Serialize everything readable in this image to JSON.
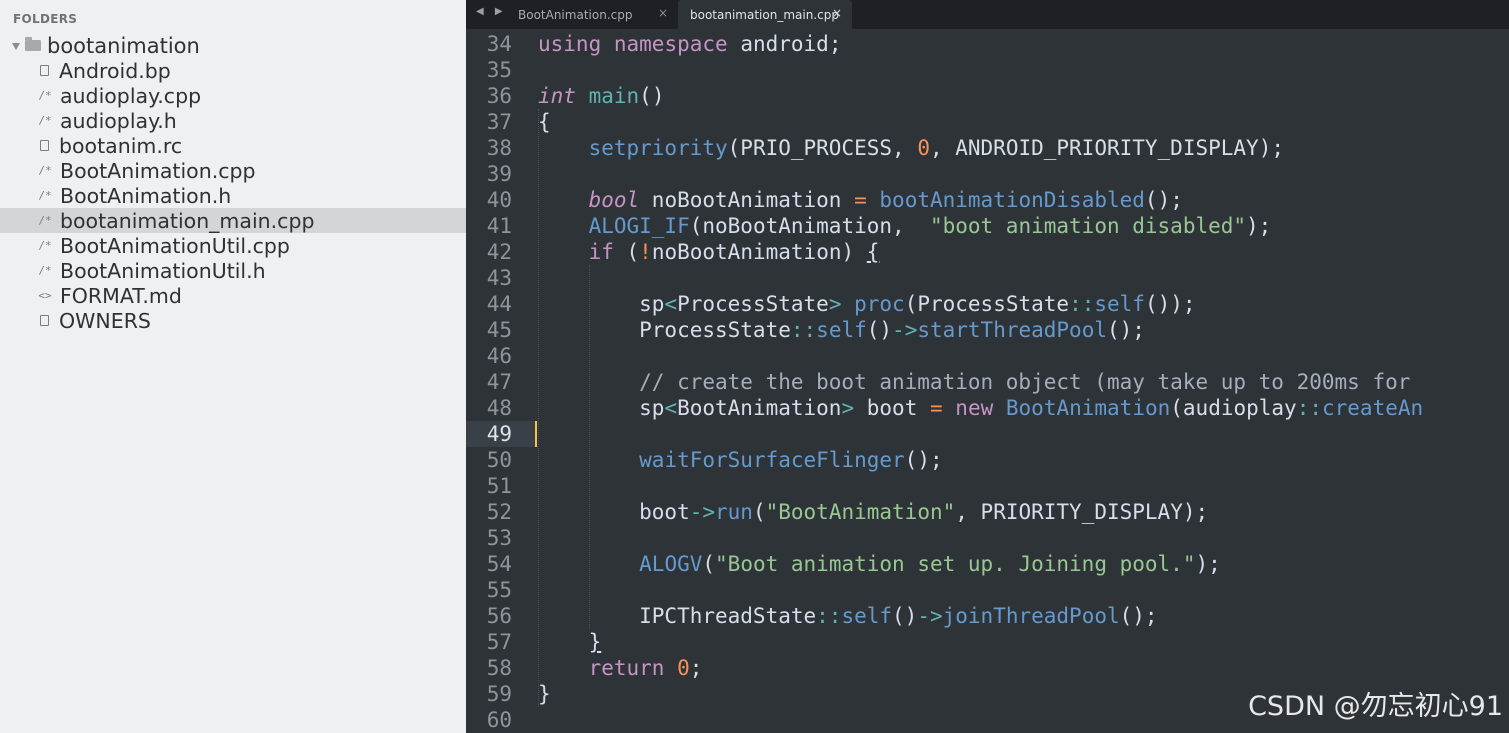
{
  "sidebar": {
    "title": "FOLDERS",
    "root_folder": "bootanimation",
    "files": [
      {
        "name": "Android.bp",
        "icon": "document-icon",
        "glyph": ""
      },
      {
        "name": "audioplay.cpp",
        "icon": "comment-code-icon",
        "glyph": "/*"
      },
      {
        "name": "audioplay.h",
        "icon": "comment-code-icon",
        "glyph": "/*"
      },
      {
        "name": "bootanim.rc",
        "icon": "document-icon",
        "glyph": ""
      },
      {
        "name": "BootAnimation.cpp",
        "icon": "comment-code-icon",
        "glyph": "/*"
      },
      {
        "name": "BootAnimation.h",
        "icon": "comment-code-icon",
        "glyph": "/*"
      },
      {
        "name": "bootanimation_main.cpp",
        "icon": "comment-code-icon",
        "glyph": "/*",
        "selected": true
      },
      {
        "name": "BootAnimationUtil.cpp",
        "icon": "comment-code-icon",
        "glyph": "/*"
      },
      {
        "name": "BootAnimationUtil.h",
        "icon": "comment-code-icon",
        "glyph": "/*"
      },
      {
        "name": "FORMAT.md",
        "icon": "markup-icon",
        "glyph": "<>"
      },
      {
        "name": "OWNERS",
        "icon": "document-icon",
        "glyph": ""
      }
    ]
  },
  "tabs": [
    {
      "label": "BootAnimation.cpp",
      "active": false,
      "close": "×"
    },
    {
      "label": "bootanimation_main.cpp",
      "active": true,
      "close": "×"
    }
  ],
  "nav_arrows": "◀ ▶",
  "editor": {
    "current_line": 49,
    "lines": [
      {
        "n": 34,
        "tokens": [
          [
            "kw",
            "using"
          ],
          [
            "pl",
            " "
          ],
          [
            "kw",
            "namespace"
          ],
          [
            "pl",
            " android;"
          ]
        ]
      },
      {
        "n": 35,
        "tokens": []
      },
      {
        "n": 36,
        "tokens": [
          [
            "ty",
            "int"
          ],
          [
            "pl",
            " "
          ],
          [
            "op",
            "main"
          ],
          [
            "pl",
            "()"
          ]
        ]
      },
      {
        "n": 37,
        "tokens": [
          [
            "pl",
            "{"
          ]
        ]
      },
      {
        "n": 38,
        "tokens": [
          [
            "pl",
            "    "
          ],
          [
            "fn",
            "setpriority"
          ],
          [
            "pl",
            "(PRIO_PROCESS, "
          ],
          [
            "nm",
            "0"
          ],
          [
            "pl",
            ", ANDROID_PRIORITY_DISPLAY);"
          ]
        ]
      },
      {
        "n": 39,
        "tokens": []
      },
      {
        "n": 40,
        "tokens": [
          [
            "pl",
            "    "
          ],
          [
            "ty",
            "bool"
          ],
          [
            "pl",
            " noBootAnimation "
          ],
          [
            "nm",
            "="
          ],
          [
            "pl",
            " "
          ],
          [
            "fn",
            "bootAnimationDisabled"
          ],
          [
            "pl",
            "();"
          ]
        ]
      },
      {
        "n": 41,
        "tokens": [
          [
            "pl",
            "    "
          ],
          [
            "fn",
            "ALOGI_IF"
          ],
          [
            "pl",
            "(noBootAnimation,  "
          ],
          [
            "st",
            "\"boot animation disabled\""
          ],
          [
            "pl",
            ");"
          ]
        ]
      },
      {
        "n": 42,
        "tokens": [
          [
            "pl",
            "    "
          ],
          [
            "kw",
            "if"
          ],
          [
            "pl",
            " ("
          ],
          [
            "nm",
            "!"
          ],
          [
            "pl",
            "noBootAnimation) "
          ],
          [
            "u",
            "{"
          ]
        ]
      },
      {
        "n": 43,
        "tokens": []
      },
      {
        "n": 44,
        "tokens": [
          [
            "pl",
            "        sp"
          ],
          [
            "op",
            "<"
          ],
          [
            "pl",
            "ProcessState"
          ],
          [
            "op",
            ">"
          ],
          [
            "pl",
            " "
          ],
          [
            "fn",
            "proc"
          ],
          [
            "pl",
            "(ProcessState"
          ],
          [
            "op",
            "::"
          ],
          [
            "fn",
            "self"
          ],
          [
            "pl",
            "());"
          ]
        ]
      },
      {
        "n": 45,
        "tokens": [
          [
            "pl",
            "        ProcessState"
          ],
          [
            "op",
            "::"
          ],
          [
            "fn",
            "self"
          ],
          [
            "pl",
            "()"
          ],
          [
            "op",
            "->"
          ],
          [
            "fn",
            "startThreadPool"
          ],
          [
            "pl",
            "();"
          ]
        ]
      },
      {
        "n": 46,
        "tokens": []
      },
      {
        "n": 47,
        "tokens": [
          [
            "cm",
            "        // create the boot animation object (may take up to 200ms for"
          ]
        ]
      },
      {
        "n": 48,
        "tokens": [
          [
            "pl",
            "        sp"
          ],
          [
            "op",
            "<"
          ],
          [
            "pl",
            "BootAnimation"
          ],
          [
            "op",
            ">"
          ],
          [
            "pl",
            " boot "
          ],
          [
            "nm",
            "="
          ],
          [
            "pl",
            " "
          ],
          [
            "kw",
            "new"
          ],
          [
            "pl",
            " "
          ],
          [
            "fn",
            "BootAnimation"
          ],
          [
            "pl",
            "(audioplay"
          ],
          [
            "op",
            "::"
          ],
          [
            "fn",
            "createAn"
          ]
        ]
      },
      {
        "n": 49,
        "tokens": []
      },
      {
        "n": 50,
        "tokens": [
          [
            "pl",
            "        "
          ],
          [
            "fn",
            "waitForSurfaceFlinger"
          ],
          [
            "pl",
            "();"
          ]
        ]
      },
      {
        "n": 51,
        "tokens": []
      },
      {
        "n": 52,
        "tokens": [
          [
            "pl",
            "        boot"
          ],
          [
            "op",
            "->"
          ],
          [
            "fn",
            "run"
          ],
          [
            "pl",
            "("
          ],
          [
            "st",
            "\"BootAnimation\""
          ],
          [
            "pl",
            ", PRIORITY_DISPLAY);"
          ]
        ]
      },
      {
        "n": 53,
        "tokens": []
      },
      {
        "n": 54,
        "tokens": [
          [
            "pl",
            "        "
          ],
          [
            "fn",
            "ALOGV"
          ],
          [
            "pl",
            "("
          ],
          [
            "st",
            "\"Boot animation set up. Joining pool.\""
          ],
          [
            "pl",
            ");"
          ]
        ]
      },
      {
        "n": 55,
        "tokens": []
      },
      {
        "n": 56,
        "tokens": [
          [
            "pl",
            "        IPCThreadState"
          ],
          [
            "op",
            "::"
          ],
          [
            "fn",
            "self"
          ],
          [
            "pl",
            "()"
          ],
          [
            "op",
            "->"
          ],
          [
            "fn",
            "joinThreadPool"
          ],
          [
            "pl",
            "();"
          ]
        ]
      },
      {
        "n": 57,
        "tokens": [
          [
            "pl",
            "    "
          ],
          [
            "u",
            "}"
          ]
        ]
      },
      {
        "n": 58,
        "tokens": [
          [
            "pl",
            "    "
          ],
          [
            "kw",
            "return"
          ],
          [
            "pl",
            " "
          ],
          [
            "nm",
            "0"
          ],
          [
            "pl",
            ";"
          ]
        ]
      },
      {
        "n": 59,
        "tokens": [
          [
            "pl",
            "}"
          ]
        ]
      },
      {
        "n": 60,
        "tokens": []
      }
    ]
  },
  "watermark": "CSDN @勿忘初心91",
  "colors": {
    "sidebar_bg": "#eff0f1",
    "editor_bg": "#2e3338",
    "tabbar_bg": "#1d2024",
    "caret": "#f9c04a",
    "keyword": "#c594c5",
    "function": "#6699cc",
    "number": "#f99157",
    "string": "#99c794",
    "operator": "#5fb3b3"
  }
}
